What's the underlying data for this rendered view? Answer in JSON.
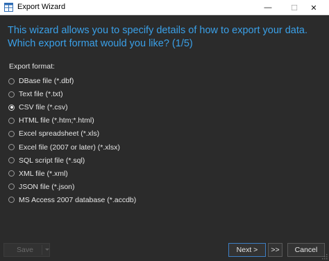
{
  "window": {
    "title": "Export Wizard",
    "minimize_glyph": "—",
    "maximize_glyph": "☐",
    "close_glyph": "✕"
  },
  "wizard": {
    "heading": "This wizard allows you to specify details of how to export your data. Which export format would you like? (1/5)",
    "format_label": "Export format:",
    "selected_index": 2,
    "options": [
      {
        "label": "DBase file (*.dbf)"
      },
      {
        "label": "Text file (*.txt)"
      },
      {
        "label": "CSV file (*.csv)"
      },
      {
        "label": "HTML file (*.htm;*.html)"
      },
      {
        "label": "Excel spreadsheet (*.xls)"
      },
      {
        "label": "Excel file (2007 or later) (*.xlsx)"
      },
      {
        "label": "SQL script file (*.sql)"
      },
      {
        "label": "XML file (*.xml)"
      },
      {
        "label": "JSON file (*.json)"
      },
      {
        "label": "MS Access 2007 database (*.accdb)"
      }
    ]
  },
  "footer": {
    "save_label": "Save",
    "next_label": "Next >",
    "finish_label": ">>",
    "cancel_label": "Cancel"
  },
  "colors": {
    "background": "#2b2b2b",
    "heading": "#3aa0e8",
    "text": "#e6e6e6",
    "accent_border": "#3d7fc4"
  }
}
